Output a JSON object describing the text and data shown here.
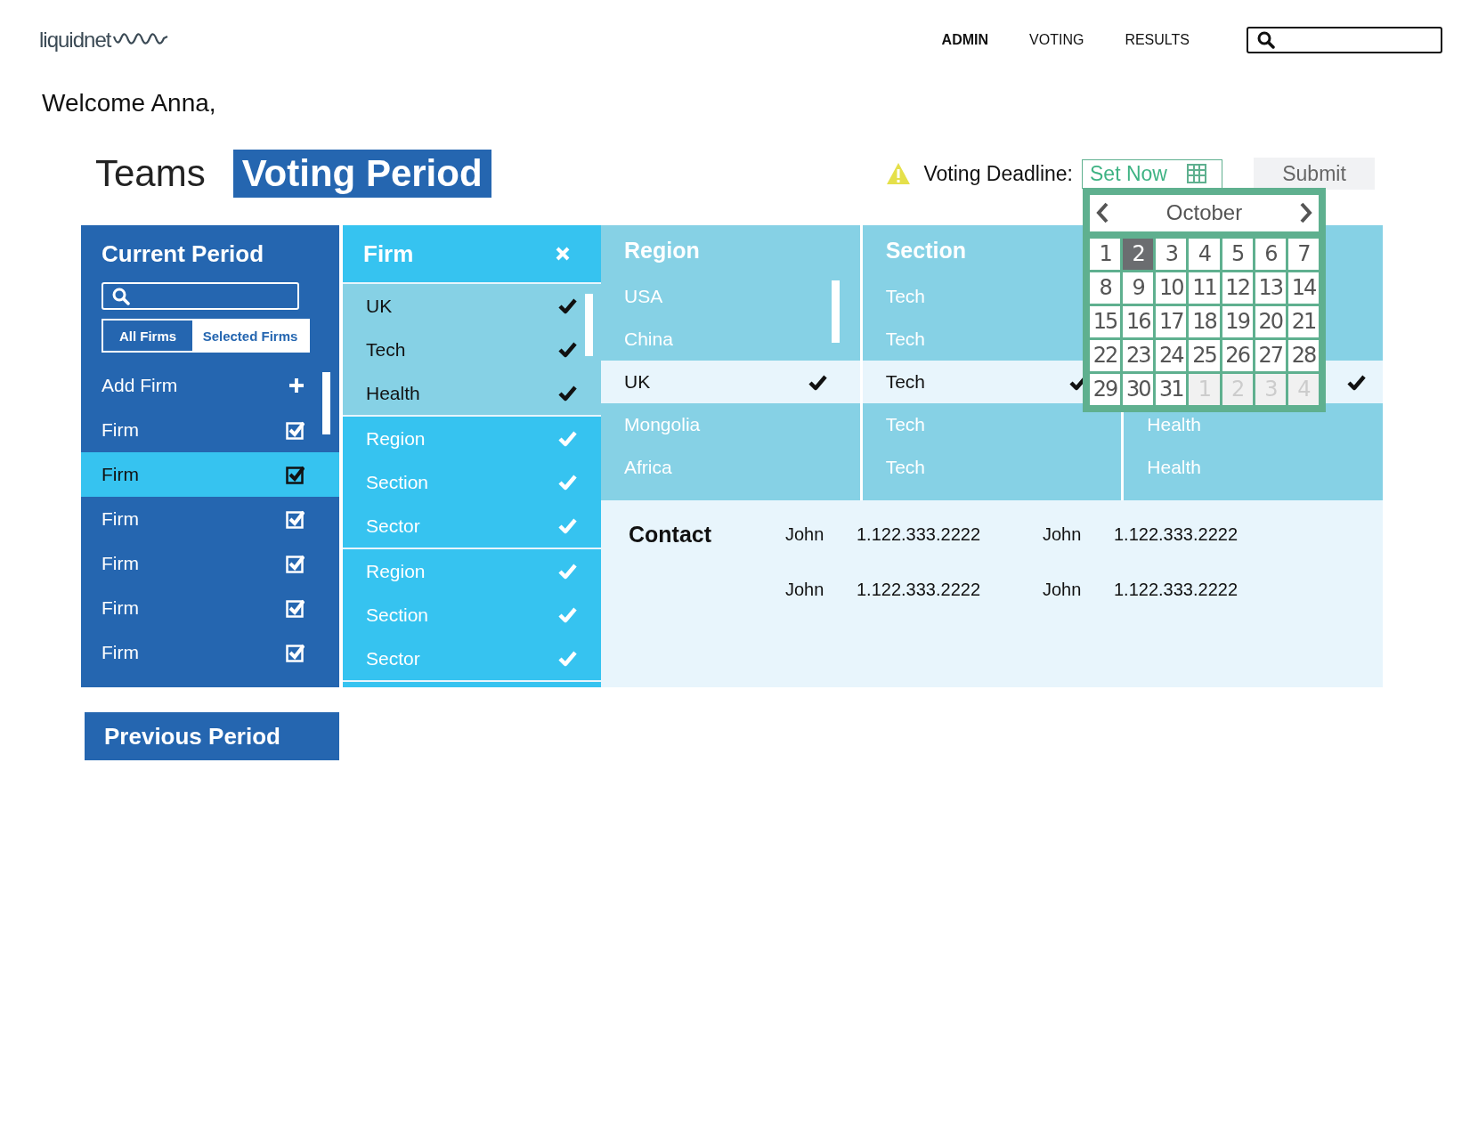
{
  "logo": {
    "text": "liquidnet"
  },
  "nav": [
    {
      "label": "ADMIN",
      "selected": true
    },
    {
      "label": "VOTING",
      "selected": false
    },
    {
      "label": "RESULTS",
      "selected": false
    }
  ],
  "welcome": "Welcome Anna,",
  "tabs": [
    {
      "label": "Teams",
      "selected": false
    },
    {
      "label": "Voting Period",
      "selected": true
    }
  ],
  "deadline": {
    "label": "Voting Deadline:",
    "value": "Set Now"
  },
  "submit": "Submit",
  "calendar": {
    "month": "October",
    "days": [
      {
        "label": "1",
        "selected": false,
        "outside": false
      },
      {
        "label": "2",
        "selected": true,
        "outside": false
      },
      {
        "label": "3",
        "selected": false,
        "outside": false
      },
      {
        "label": "4",
        "selected": false,
        "outside": false
      },
      {
        "label": "5",
        "selected": false,
        "outside": false
      },
      {
        "label": "6",
        "selected": false,
        "outside": false
      },
      {
        "label": "7",
        "selected": false,
        "outside": false
      },
      {
        "label": "8",
        "selected": false,
        "outside": false
      },
      {
        "label": "9",
        "selected": false,
        "outside": false
      },
      {
        "label": "10",
        "selected": false,
        "outside": false
      },
      {
        "label": "11",
        "selected": false,
        "outside": false
      },
      {
        "label": "12",
        "selected": false,
        "outside": false
      },
      {
        "label": "13",
        "selected": false,
        "outside": false
      },
      {
        "label": "14",
        "selected": false,
        "outside": false
      },
      {
        "label": "15",
        "selected": false,
        "outside": false
      },
      {
        "label": "16",
        "selected": false,
        "outside": false
      },
      {
        "label": "17",
        "selected": false,
        "outside": false
      },
      {
        "label": "18",
        "selected": false,
        "outside": false
      },
      {
        "label": "19",
        "selected": false,
        "outside": false
      },
      {
        "label": "20",
        "selected": false,
        "outside": false
      },
      {
        "label": "21",
        "selected": false,
        "outside": false
      },
      {
        "label": "22",
        "selected": false,
        "outside": false
      },
      {
        "label": "23",
        "selected": false,
        "outside": false
      },
      {
        "label": "24",
        "selected": false,
        "outside": false
      },
      {
        "label": "25",
        "selected": false,
        "outside": false
      },
      {
        "label": "26",
        "selected": false,
        "outside": false
      },
      {
        "label": "27",
        "selected": false,
        "outside": false
      },
      {
        "label": "28",
        "selected": false,
        "outside": false
      },
      {
        "label": "29",
        "selected": false,
        "outside": false
      },
      {
        "label": "30",
        "selected": false,
        "outside": false
      },
      {
        "label": "31",
        "selected": false,
        "outside": false
      },
      {
        "label": "1",
        "selected": false,
        "outside": true
      },
      {
        "label": "2",
        "selected": false,
        "outside": true
      },
      {
        "label": "3",
        "selected": false,
        "outside": true
      },
      {
        "label": "4",
        "selected": false,
        "outside": true
      }
    ]
  },
  "current_period": {
    "title": "Current Period",
    "filter_tabs": [
      {
        "label": "All Firms",
        "selected": false
      },
      {
        "label": "Selected Firms",
        "selected": true
      }
    ],
    "add_label": "Add Firm",
    "firms": [
      {
        "name": "Firm",
        "checked": true,
        "selected": false
      },
      {
        "name": "Firm",
        "checked": true,
        "selected": true
      },
      {
        "name": "Firm",
        "checked": true,
        "selected": false
      },
      {
        "name": "Firm",
        "checked": true,
        "selected": false
      },
      {
        "name": "Firm",
        "checked": true,
        "selected": false
      },
      {
        "name": "Firm",
        "checked": true,
        "selected": false
      }
    ]
  },
  "firm_column": {
    "title": "Firm",
    "groups": [
      {
        "selected": true,
        "items": [
          {
            "label": "UK",
            "checked": true
          },
          {
            "label": "Tech",
            "checked": true
          },
          {
            "label": "Health",
            "checked": true
          }
        ]
      },
      {
        "selected": false,
        "items": [
          {
            "label": "Region",
            "checked": true
          },
          {
            "label": "Section",
            "checked": true
          },
          {
            "label": "Sector",
            "checked": true
          }
        ]
      },
      {
        "selected": false,
        "items": [
          {
            "label": "Region",
            "checked": true
          },
          {
            "label": "Section",
            "checked": true
          },
          {
            "label": "Sector",
            "checked": true
          }
        ]
      }
    ]
  },
  "columns": [
    {
      "title": "Region",
      "items": [
        {
          "label": "USA",
          "selected": false
        },
        {
          "label": "China",
          "selected": false
        },
        {
          "label": "UK",
          "selected": true
        },
        {
          "label": "Mongolia",
          "selected": false
        },
        {
          "label": "Africa",
          "selected": false
        }
      ]
    },
    {
      "title": "Section",
      "items": [
        {
          "label": "Tech",
          "selected": false
        },
        {
          "label": "Tech",
          "selected": false
        },
        {
          "label": "Tech",
          "selected": true
        },
        {
          "label": "Tech",
          "selected": false
        },
        {
          "label": "Tech",
          "selected": false
        }
      ]
    },
    {
      "items": [
        {
          "selected": true
        },
        {
          "label": "Health",
          "selected": false
        },
        {
          "label": "Health",
          "selected": false
        }
      ]
    }
  ],
  "contact": {
    "title": "Contact",
    "entries": [
      {
        "name": "John",
        "phone": "1.122.333.2222"
      },
      {
        "name": "John",
        "phone": "1.122.333.2222"
      },
      {
        "name": "John",
        "phone": "1.122.333.2222"
      },
      {
        "name": "John",
        "phone": "1.122.333.2222"
      }
    ]
  },
  "previous_period": "Previous Period"
}
